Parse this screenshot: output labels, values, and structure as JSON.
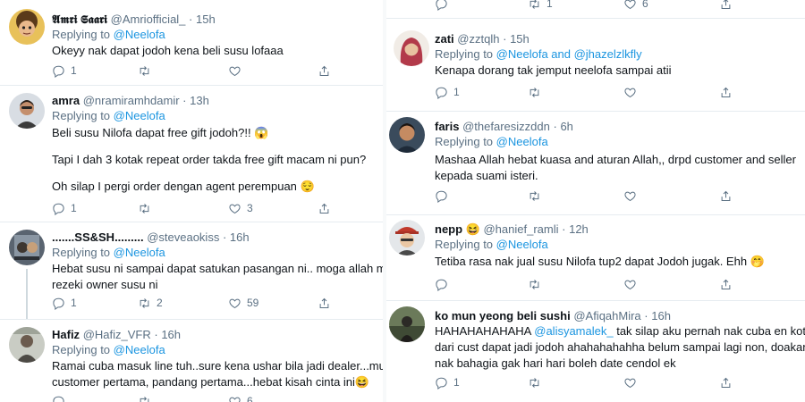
{
  "left": [
    {
      "name": "𝕬𝖒𝖗𝖎 𝕾𝖆𝖆𝖗𝖎",
      "handle": "@Amriofficial_",
      "time": "15h",
      "reply_prefix": "Replying to",
      "mention": "@Neelofa",
      "lines": [
        "Okeyy nak dapat jodoh kena beli susu lofaaa"
      ],
      "replies": "1",
      "retweets": "",
      "likes": ""
    },
    {
      "name": "amra",
      "handle": "@nramiramhdamir",
      "time": "13h",
      "reply_prefix": "Replying to",
      "mention": "@Neelofa",
      "lines": [
        "Beli susu Nilofa dapat free gift jodoh?!! 😱",
        "",
        "Tapi I dah 3 kotak repeat order takda free gift macam ni pun?",
        "",
        "Oh silap I pergi order dengan agent perempuan 😌"
      ],
      "replies": "1",
      "retweets": "",
      "likes": "3"
    },
    {
      "name": ".......SS&SH.........",
      "handle": "@steveaokiss",
      "time": "16h",
      "reply_prefix": "Replying to",
      "mention": "@Neelofa",
      "lines": [
        "Hebat susu ni sampai dapat satukan pasangan ni.. moga allah murahka",
        "rezeki owner susu ni"
      ],
      "replies": "1",
      "retweets": "2",
      "likes": "59"
    },
    {
      "name": "Hafiz",
      "handle": "@Hafiz_VFR",
      "time": "16h",
      "reply_prefix": "Replying to",
      "mention": "@Neelofa",
      "lines": [
        "Ramai cuba masuk line tuh..sure kena ushar bila jadi dealer...mungkin",
        "customer pertama, pandang pertama...hebat kisah cinta ini😆"
      ],
      "replies": "",
      "retweets": "",
      "likes": "6"
    }
  ],
  "right": [
    {
      "top_actions": {
        "replies": "",
        "retweets": "1",
        "likes": "6"
      }
    },
    {
      "name": "zati",
      "handle": "@zztqlh",
      "time": "15h",
      "reply_prefix": "Replying to",
      "mention": "@Neelofa and @jhazelzlkfly",
      "lines": [
        "Kenapa dorang tak jemput neelofa sampai atii"
      ],
      "replies": "1",
      "retweets": "",
      "likes": ""
    },
    {
      "name": "faris",
      "handle": "@thefaresizzddn",
      "time": "6h",
      "reply_prefix": "Replying to",
      "mention": "@Neelofa",
      "lines": [
        "Mashaa Allah hebat kuasa and aturan Allah,, drpd customer and seller",
        "kepada suami isteri."
      ],
      "replies": "",
      "retweets": "",
      "likes": ""
    },
    {
      "name": "nepp 😆",
      "handle": "@hanief_ramli",
      "time": "12h",
      "reply_prefix": "Replying to",
      "mention": "@Neelofa",
      "lines": [
        "Tetiba rasa nak jual susu Nilofa tup2 dapat Jodoh jugak. Ehh 🤭"
      ],
      "replies": "",
      "retweets": "",
      "likes": ""
    },
    {
      "name": "ko mun yeong beli sushi",
      "handle": "@AfiqahMira",
      "time": "16h",
      "reply_prefix": "",
      "mention": "",
      "line1_a": "HAHAHAHAHAHA ",
      "line1_mention": "@alisyamalek_",
      "line1_b": " tak silap aku pernah nak cuba en kot ko",
      "lines": [
        "dari cust dapat jadi jodoh ahahahahahha belum sampai lagi non, doakan a",
        "nak bahagia gak hari hari boleh date cendol ek"
      ],
      "replies": "1",
      "retweets": "",
      "likes": ""
    }
  ],
  "dot": "·",
  "colors": {
    "accent": "#1b95e0",
    "muted": "#5b7083",
    "text": "#0f1419",
    "border": "#e6ecf0"
  }
}
